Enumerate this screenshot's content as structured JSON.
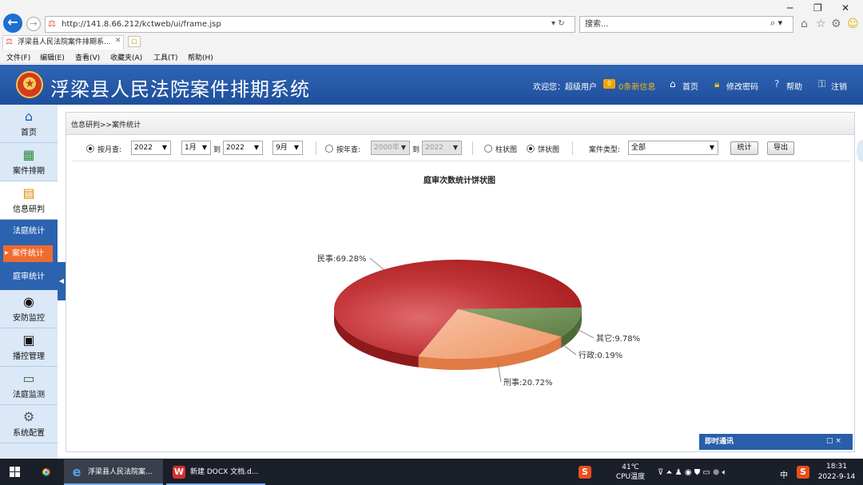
{
  "browser": {
    "url": "http://141.8.66.212/kctweb/ui/frame.jsp",
    "search_placeholder": "搜索...",
    "tab_title": "浮梁县人民法院案件排期系...",
    "menu": [
      "文件(F)",
      "编辑(E)",
      "查看(V)",
      "收藏夹(A)",
      "工具(T)",
      "帮助(H)"
    ]
  },
  "header": {
    "title": "浮梁县人民法院案件排期系统",
    "welcome": "欢迎您：超级用户",
    "msg_count": "0",
    "msg_label": "0条新信息",
    "home": "首页",
    "change_password": "修改密码",
    "help": "帮助",
    "logout": "注销"
  },
  "sidebar": {
    "items": [
      {
        "label": "首页",
        "icon": "home-icon"
      },
      {
        "label": "案件排期",
        "icon": "calendar-icon"
      },
      {
        "label": "信息研判",
        "icon": "chart-icon"
      },
      {
        "label": "安防监控",
        "icon": "camera-icon"
      },
      {
        "label": "播控管理",
        "icon": "film-icon"
      },
      {
        "label": "法庭监测",
        "icon": "monitor-icon"
      },
      {
        "label": "系统配置",
        "icon": "gear-icon"
      }
    ],
    "sub": [
      "法庭统计",
      "案件统计",
      "庭审统计"
    ]
  },
  "breadcrumb": "信息研判>>案件统计",
  "filters": {
    "by_month_label": "按月查:",
    "year_from": "2022",
    "month_from": "1月",
    "to1": "到",
    "year_to": "2022",
    "month_to": "9月",
    "by_year_label": "按年查:",
    "year_start": "2000年",
    "to2": "到",
    "year_end": "2022",
    "bar_label": "柱状图",
    "pie_label": "饼状图",
    "case_type_label": "案件类型:",
    "case_type": "全部",
    "stat_button": "统计",
    "export_button": "导出"
  },
  "chart_data": {
    "type": "pie",
    "title": "庭审次数统计饼状图",
    "slices": [
      {
        "name": "民事",
        "value": 69.28,
        "label": "民事:69.28%",
        "color": "#b8282a"
      },
      {
        "name": "其它",
        "value": 9.78,
        "label": "其它:9.78%",
        "color": "#6e8c56"
      },
      {
        "name": "行政",
        "value": 0.19,
        "label": "行政:0.19%",
        "color": "#c9602e"
      },
      {
        "name": "刑事",
        "value": 20.72,
        "label": "刑事:20.72%",
        "color": "#f0a07a"
      }
    ]
  },
  "chat": {
    "title": "即时通讯",
    "controls": "□ ×"
  },
  "taskbar": {
    "apps": [
      {
        "label": "浮梁县人民法院案..."
      },
      {
        "label": "新建 DOCX 文档.d..."
      }
    ],
    "temp": "41℃",
    "temp_label": "CPU温度",
    "ime": "中",
    "time": "18:31",
    "date": "2022-9-14"
  }
}
